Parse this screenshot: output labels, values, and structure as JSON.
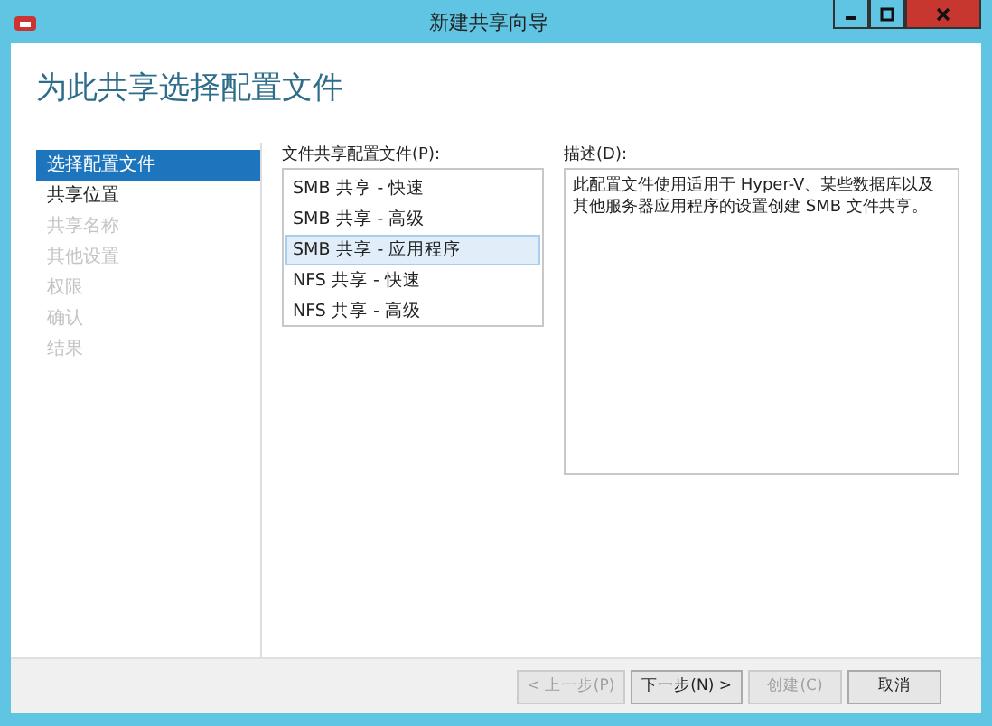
{
  "window": {
    "title": "新建共享向导"
  },
  "heading": "为此共享选择配置文件",
  "steps": [
    {
      "label": "选择配置文件",
      "selected": true,
      "disabled": false
    },
    {
      "label": "共享位置",
      "selected": false,
      "disabled": false
    },
    {
      "label": "共享名称",
      "selected": false,
      "disabled": true
    },
    {
      "label": "其他设置",
      "selected": false,
      "disabled": true
    },
    {
      "label": "权限",
      "selected": false,
      "disabled": true
    },
    {
      "label": "确认",
      "selected": false,
      "disabled": true
    },
    {
      "label": "结果",
      "selected": false,
      "disabled": true
    }
  ],
  "profiles": {
    "label": "文件共享配置文件(P):",
    "items": [
      {
        "label": "SMB 共享 - 快速",
        "selected": false
      },
      {
        "label": "SMB 共享 - 高级",
        "selected": false
      },
      {
        "label": "SMB 共享 - 应用程序",
        "selected": true
      },
      {
        "label": "NFS 共享 - 快速",
        "selected": false
      },
      {
        "label": "NFS 共享 - 高级",
        "selected": false
      }
    ]
  },
  "description": {
    "label": "描述(D):",
    "text": "此配置文件使用适用于 Hyper-V、某些数据库以及其他服务器应用程序的设置创建 SMB 文件共享。"
  },
  "buttons": [
    {
      "label": "< 上一步(P)",
      "disabled": true
    },
    {
      "label": "下一步(N) >",
      "disabled": false
    },
    {
      "label": "创建(C)",
      "disabled": true
    },
    {
      "label": "取消",
      "disabled": false
    }
  ]
}
